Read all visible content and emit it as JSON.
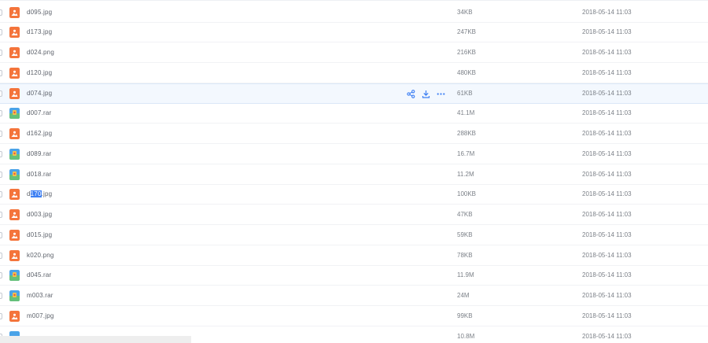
{
  "rows": [
    {
      "name": "d095.jpg",
      "size": "34KB",
      "date": "2018-05-14 11:03",
      "type": "image"
    },
    {
      "name": "d173.jpg",
      "size": "247KB",
      "date": "2018-05-14 11:03",
      "type": "image"
    },
    {
      "name": "d024.png",
      "size": "216KB",
      "date": "2018-05-14 11:03",
      "type": "image"
    },
    {
      "name": "d120.jpg",
      "size": "480KB",
      "date": "2018-05-14 11:03",
      "type": "image"
    },
    {
      "name": "d074.jpg",
      "size": "61KB",
      "date": "2018-05-14 11:03",
      "type": "image",
      "hovered": true
    },
    {
      "name": "d007.rar",
      "size": "41.1M",
      "date": "2018-05-14 11:03",
      "type": "archive"
    },
    {
      "name": "d162.jpg",
      "size": "288KB",
      "date": "2018-05-14 11:03",
      "type": "image"
    },
    {
      "name": "d089.rar",
      "size": "16.7M",
      "date": "2018-05-14 11:03",
      "type": "archive"
    },
    {
      "name": "d018.rar",
      "size": "11.2M",
      "date": "2018-05-14 11:03",
      "type": "archive"
    },
    {
      "name_before": "d",
      "name_selected": "170",
      "name_after": ".jpg",
      "size": "100KB",
      "date": "2018-05-14 11:03",
      "type": "image"
    },
    {
      "name": "d003.jpg",
      "size": "47KB",
      "date": "2018-05-14 11:03",
      "type": "image"
    },
    {
      "name": "d015.jpg",
      "size": "59KB",
      "date": "2018-05-14 11:03",
      "type": "image"
    },
    {
      "name": "k020.png",
      "size": "78KB",
      "date": "2018-05-14 11:03",
      "type": "image"
    },
    {
      "name": "d045.rar",
      "size": "11.9M",
      "date": "2018-05-14 11:03",
      "type": "archive"
    },
    {
      "name": "m003.rar",
      "size": "24M",
      "date": "2018-05-14 11:03",
      "type": "archive"
    },
    {
      "name": "m007.jpg",
      "size": "99KB",
      "date": "2018-05-14 11:03",
      "type": "image"
    },
    {
      "name": "",
      "size": "10.8M",
      "date": "2018-05-14 11:03",
      "type": "partial"
    }
  ],
  "row_actions": [
    "share-icon",
    "download-icon",
    "more-icon"
  ],
  "colors": {
    "image_icon": "#f4743b",
    "archive_icon_blue": "#4aa3e8",
    "archive_icon_green": "#64c07a",
    "archive_icon_red": "#e2574c",
    "accent": "#3d7ff3",
    "hover_row": "#f3f8fe"
  }
}
